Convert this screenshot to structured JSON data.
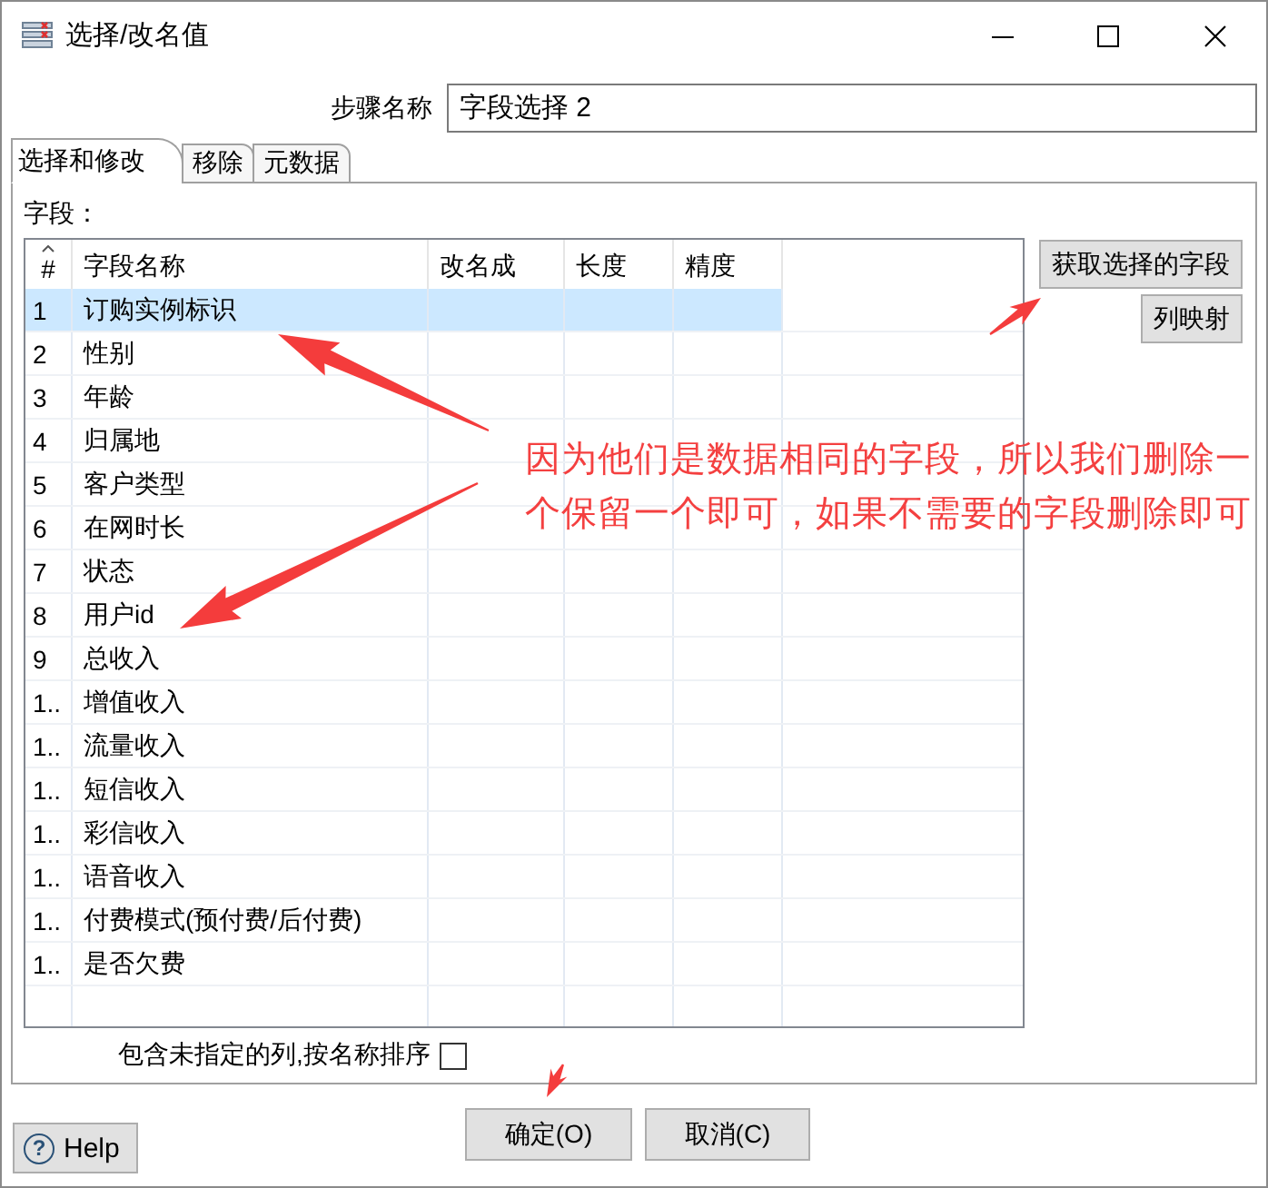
{
  "window": {
    "title": "选择/改名值"
  },
  "step_name": {
    "label": "步骤名称",
    "value": "字段选择 2"
  },
  "tabs": [
    {
      "label": "选择和修改",
      "selected": true
    },
    {
      "label": "移除",
      "selected": false
    },
    {
      "label": "元数据",
      "selected": false
    }
  ],
  "fields_label": "字段：",
  "table": {
    "columns": [
      "#",
      "字段名称",
      "改名成",
      "长度",
      "精度"
    ],
    "rows": [
      {
        "num": "1",
        "name": "订购实例标识",
        "selected": true
      },
      {
        "num": "2",
        "name": "性别",
        "selected": false
      },
      {
        "num": "3",
        "name": "年龄",
        "selected": false
      },
      {
        "num": "4",
        "name": "归属地",
        "selected": false
      },
      {
        "num": "5",
        "name": "客户类型",
        "selected": false
      },
      {
        "num": "6",
        "name": "在网时长",
        "selected": false
      },
      {
        "num": "7",
        "name": "状态",
        "selected": false
      },
      {
        "num": "8",
        "name": "用户id",
        "selected": false
      },
      {
        "num": "9",
        "name": "总收入",
        "selected": false
      },
      {
        "num": "1..",
        "name": "增值收入",
        "selected": false
      },
      {
        "num": "1..",
        "name": "流量收入",
        "selected": false
      },
      {
        "num": "1..",
        "name": "短信收入",
        "selected": false
      },
      {
        "num": "1..",
        "name": "彩信收入",
        "selected": false
      },
      {
        "num": "1..",
        "name": "语音收入",
        "selected": false
      },
      {
        "num": "1..",
        "name": "付费模式(预付费/后付费)",
        "selected": false
      },
      {
        "num": "1..",
        "name": "是否欠费",
        "selected": false
      }
    ]
  },
  "side_buttons": [
    "获取选择的字段",
    "列映射"
  ],
  "include_unspecified": {
    "label": "包含未指定的列,按名称排序",
    "checked": false
  },
  "buttons": [
    "确定(O)",
    "取消(C)"
  ],
  "help_button": {
    "icon": "?",
    "label": "Help"
  },
  "annotation": {
    "text": "因为他们是数据相同的字段，所以我们删除一个保留一个即可，如果不需要的字段删除即可"
  }
}
